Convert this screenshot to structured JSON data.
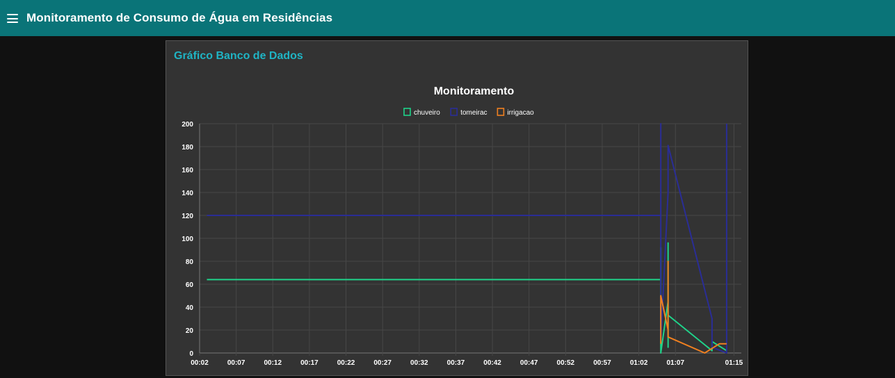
{
  "app": {
    "title": "Monitoramento de Consumo de Água em Residências"
  },
  "card": {
    "title": "Gráfico Banco de Dados"
  },
  "colors": {
    "topbar": "#0a7478",
    "background": "#111111",
    "card": "#333333",
    "accent": "#1fb4c4",
    "chuveiro": "#1fd38a",
    "tomeirac": "#2a2d96",
    "irrigacao": "#f08020"
  },
  "chart_data": {
    "type": "line",
    "title": "Monitoramento",
    "xlabel": "",
    "ylabel": "",
    "ylim": [
      0,
      200
    ],
    "yticks": [
      0,
      20,
      40,
      60,
      80,
      100,
      120,
      140,
      160,
      180,
      200
    ],
    "xlim": [
      "00:02",
      "01:16"
    ],
    "xticks": [
      "00:02",
      "00:07",
      "00:12",
      "00:17",
      "00:22",
      "00:27",
      "00:32",
      "00:37",
      "00:42",
      "00:47",
      "00:52",
      "00:57",
      "01:02",
      "01:07",
      "01:15"
    ],
    "grid": true,
    "legend_position": "top-center",
    "series": [
      {
        "name": "chuveiro",
        "color": "#1fd38a",
        "points": [
          [
            "00:03",
            64
          ],
          [
            "01:05",
            64
          ],
          [
            "01:05",
            92
          ],
          [
            "01:05",
            64
          ],
          [
            "01:05",
            0
          ],
          [
            "01:06",
            45
          ],
          [
            "01:06",
            5
          ],
          [
            "01:06",
            96
          ],
          [
            "01:06",
            33
          ],
          [
            "01:12",
            2
          ],
          [
            "01:12",
            10
          ],
          [
            "01:14",
            2
          ]
        ]
      },
      {
        "name": "tomeirac",
        "color": "#2a2d96",
        "points": [
          [
            "00:03",
            120
          ],
          [
            "01:05",
            120
          ],
          [
            "01:05",
            200
          ],
          [
            "01:05",
            10
          ],
          [
            "01:06",
            140
          ],
          [
            "01:06",
            181
          ],
          [
            "01:12",
            30
          ],
          [
            "01:12",
            5
          ],
          [
            "01:14",
            0
          ],
          [
            "01:14",
            200
          ]
        ]
      },
      {
        "name": "irrigacao",
        "color": "#f08020",
        "points": [
          [
            "01:05",
            8
          ],
          [
            "01:05",
            50
          ],
          [
            "01:06",
            20
          ],
          [
            "01:06",
            80
          ],
          [
            "01:06",
            14
          ],
          [
            "01:11",
            0
          ],
          [
            "01:13",
            8
          ],
          [
            "01:14",
            8
          ]
        ]
      }
    ]
  }
}
